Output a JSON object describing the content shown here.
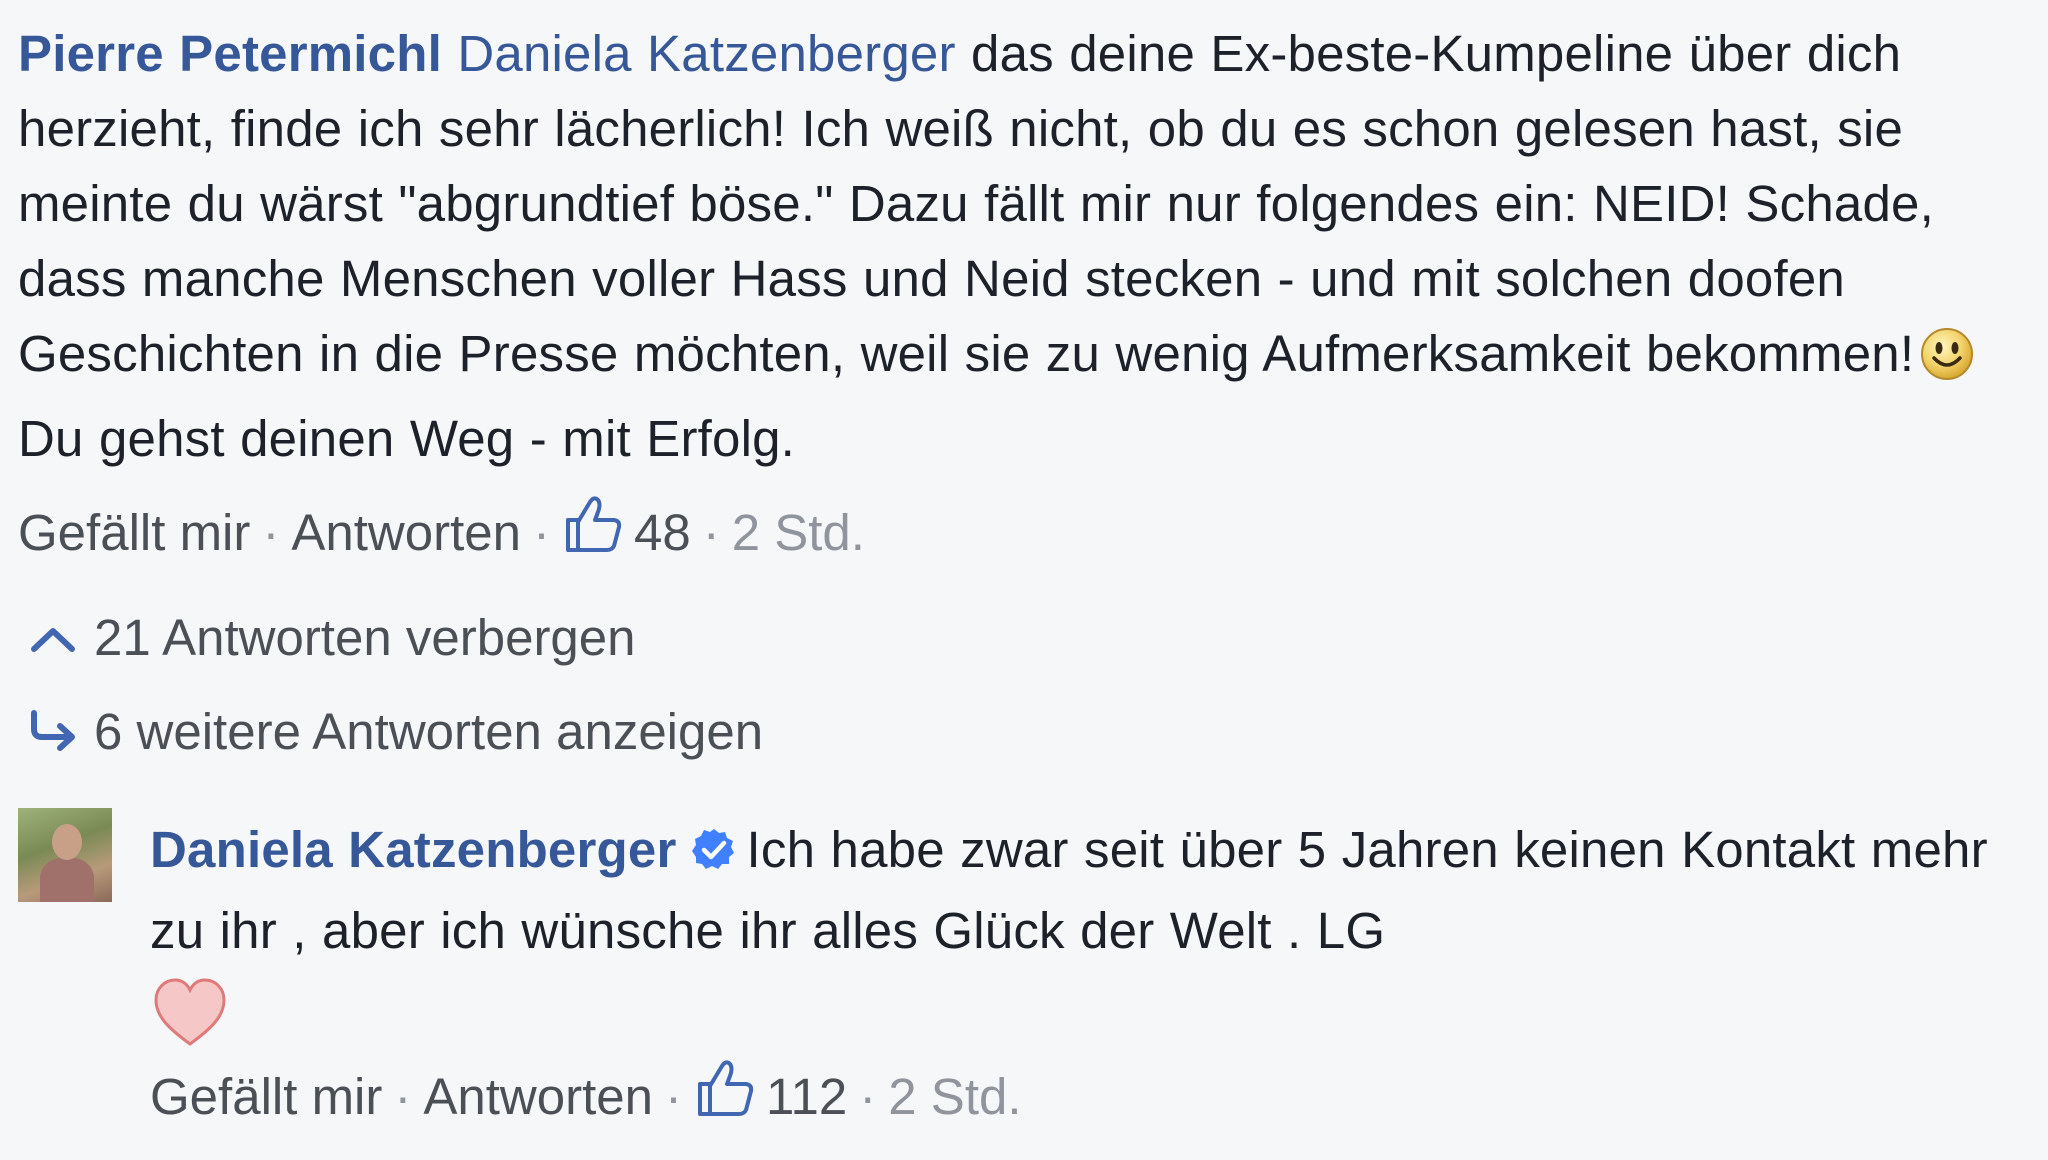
{
  "comment": {
    "author": "Pierre Petermichl",
    "mention": "Daniela Katzenberger",
    "text_before_emoji": "das deine Ex-beste-Kumpeline über dich herzieht, finde ich sehr lächerlich! Ich weiß nicht, ob du es schon gelesen hast, sie meinte du wärst \"abgrundtief böse.\" Dazu fällt mir nur folgendes ein: NEID! Schade, dass manche Menschen voller Hass und Neid stecken - und mit solchen doofen Geschichten in die Presse möchten, weil sie zu wenig Aufmerksamkeit bekommen!",
    "text_after_emoji": "Du gehst deinen Weg - mit Erfolg.",
    "emoji_icon": "smile-emoji-icon",
    "actions": {
      "like_label": "Gefällt mir",
      "reply_label": "Antworten",
      "separator": "·",
      "like_count": "48",
      "time": "2 Std."
    }
  },
  "replies_toggle": {
    "hide_label": "21 Antworten verbergen",
    "hide_icon": "chevron-up-icon",
    "more_label": "6 weitere Antworten anzeigen",
    "more_icon": "reply-arrow-icon"
  },
  "reply": {
    "author": "Daniela Katzenberger",
    "verified_icon": "verified-badge-icon",
    "text": "Ich habe zwar seit über 5 Jahren keinen Kontakt mehr zu ihr , aber ich wünsche ihr alles Glück der Welt . LG",
    "emoji_icon": "heart-emoji-icon",
    "actions": {
      "like_label": "Gefällt mir",
      "reply_label": "Antworten",
      "separator": "·",
      "like_count": "112",
      "time": "2 Std."
    }
  },
  "colors": {
    "background": "#f6f7f9",
    "link_blue": "#365899",
    "text": "#1d2129",
    "meta_gray": "#90949c",
    "verified_blue": "#4080ff",
    "heart_fill": "#f6c7c7",
    "heart_stroke": "#e07a7a"
  }
}
